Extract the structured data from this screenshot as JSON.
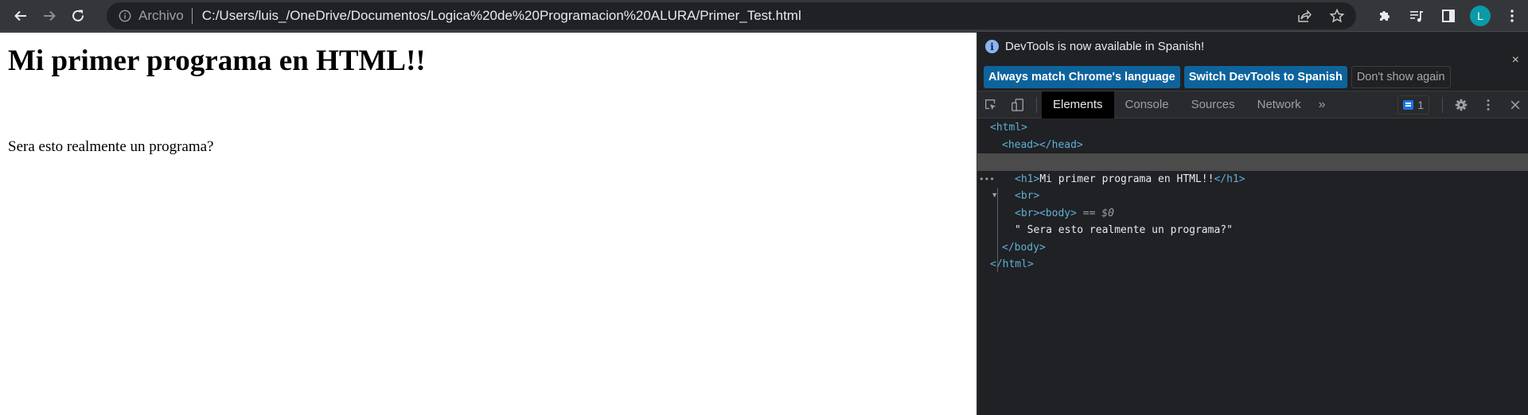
{
  "browser": {
    "omnibox": {
      "scheme_label": "Archivo",
      "url": "C:/Users/luis_/OneDrive/Documentos/Logica%20de%20Programacion%20ALURA/Primer_Test.html"
    },
    "nav_icons": [
      "back-arrow-icon",
      "forward-arrow-icon",
      "reload-icon"
    ],
    "omnibox_right_icons": [
      "share-icon",
      "bookmark-star-icon"
    ],
    "toolbar_icons": [
      "extensions-puzzle-icon",
      "media-queue-icon",
      "side-panel-icon",
      "profile-avatar",
      "kebab-menu-icon"
    ],
    "profile_initial": "L",
    "colors": {
      "avatar": "#0b9aa7",
      "toolbar_bg": "#35363a",
      "omnibox_bg": "#202124"
    }
  },
  "page": {
    "heading": "Mi primer programa en HTML!!",
    "paragraph": "Sera esto realmente un programa?"
  },
  "devtools": {
    "infobar": {
      "message": "DevTools is now available in Spanish!",
      "buttons": {
        "match_language": "Always match Chrome's language",
        "switch_spanish": "Switch DevTools to Spanish",
        "dont_show": "Don't show again"
      },
      "close_glyph": "×"
    },
    "tabs": [
      {
        "label": "Elements",
        "active": true
      },
      {
        "label": "Console",
        "active": false
      },
      {
        "label": "Sources",
        "active": false
      },
      {
        "label": "Network",
        "active": false
      }
    ],
    "more_tabs_glyph": "»",
    "issues_count": "1",
    "dom_tree": {
      "html_open": "<html>",
      "head": "<head></head>",
      "body_open": "<body>",
      "selected_marker": " == $0",
      "h1_open": "<h1>",
      "h1_text": "Mi primer programa en HTML!!",
      "h1_close": "</h1>",
      "br": "<br>",
      "text_node": "\" Sera esto realmente un programa?\"",
      "body_close": "</body>",
      "html_close": "</html>"
    },
    "colors": {
      "primary_button": "#0e639c",
      "tag": "#5db0d7",
      "selected_row": "#4b4b4b"
    }
  }
}
